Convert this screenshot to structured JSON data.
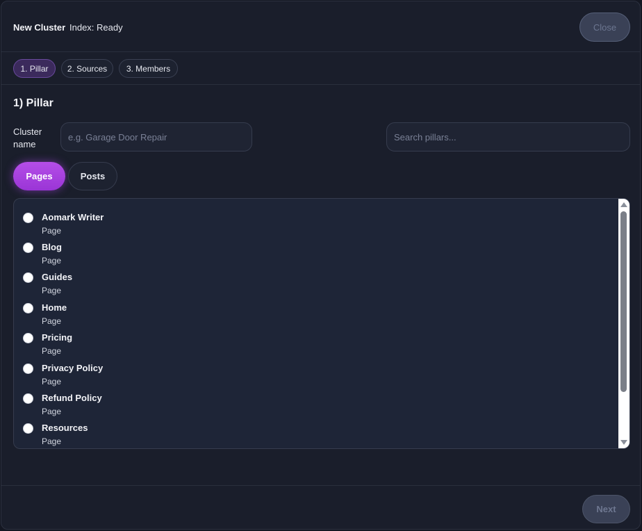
{
  "header": {
    "title": "New Cluster",
    "status": "Index: Ready",
    "close_label": "Close"
  },
  "steps": [
    {
      "label": "1. Pillar",
      "active": true
    },
    {
      "label": "2. Sources",
      "active": false
    },
    {
      "label": "3. Members",
      "active": false
    }
  ],
  "section": {
    "title": "1) Pillar",
    "cluster_label": "Cluster name",
    "cluster_placeholder": "e.g. Garage Door Repair",
    "cluster_value": "",
    "search_placeholder": "Search pillars...",
    "search_value": ""
  },
  "tabs": [
    {
      "label": "Pages",
      "active": true
    },
    {
      "label": "Posts",
      "active": false
    }
  ],
  "items": [
    {
      "name": "Aomark Writer",
      "type": "Page",
      "selected": false
    },
    {
      "name": "Blog",
      "type": "Page",
      "selected": false
    },
    {
      "name": "Guides",
      "type": "Page",
      "selected": false
    },
    {
      "name": "Home",
      "type": "Page",
      "selected": false
    },
    {
      "name": "Pricing",
      "type": "Page",
      "selected": false
    },
    {
      "name": "Privacy Policy",
      "type": "Page",
      "selected": false
    },
    {
      "name": "Refund Policy",
      "type": "Page",
      "selected": false
    },
    {
      "name": "Resources",
      "type": "Page",
      "selected": false
    }
  ],
  "footer": {
    "next_label": "Next"
  },
  "colors": {
    "accent": "#a842e0",
    "background": "#1a1e2b",
    "list_background": "#1e2537"
  }
}
